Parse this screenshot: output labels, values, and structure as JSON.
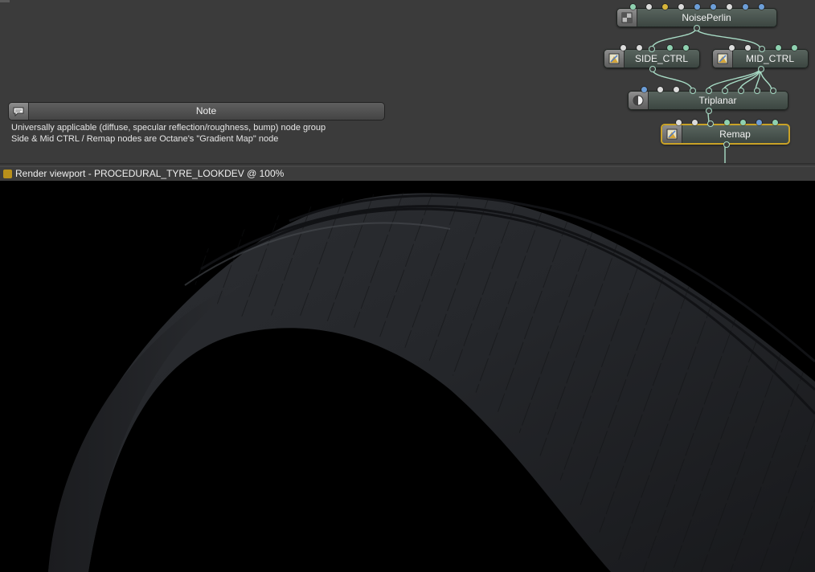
{
  "node_graph": {
    "nodes": [
      {
        "id": "noiseperlin",
        "title": "NoisePerlin",
        "icon": "texture-checker-icon"
      },
      {
        "id": "side_ctrl",
        "title": "SIDE_CTRL",
        "icon": "gradient-map-icon"
      },
      {
        "id": "mid_ctrl",
        "title": "MID_CTRL",
        "icon": "gradient-map-icon"
      },
      {
        "id": "triplanar",
        "title": "Triplanar",
        "icon": "sphere-projection-icon"
      },
      {
        "id": "remap",
        "title": "Remap",
        "icon": "gradient-map-icon",
        "selected": true
      }
    ],
    "note": {
      "title": "Note",
      "lines": [
        "Universally applicable (diffuse, specular reflection/roughness, bump) node group",
        "Side & Mid CTRL / Remap nodes are Octane's \"Gradient Map\" node"
      ]
    },
    "colors": {
      "wire": "#a8dcc6",
      "pin_green": "#8fd1b0",
      "pin_blue": "#6c9ed8",
      "pin_yellow": "#d7b53a",
      "pin_white": "#dcdcdc",
      "selection": "#c9a227"
    }
  },
  "viewport": {
    "title": "Render viewport - PROCEDURAL_TYRE_LOOKDEV @ 100%",
    "badge_color": "#b8901b",
    "render_description": "tyre-render"
  }
}
